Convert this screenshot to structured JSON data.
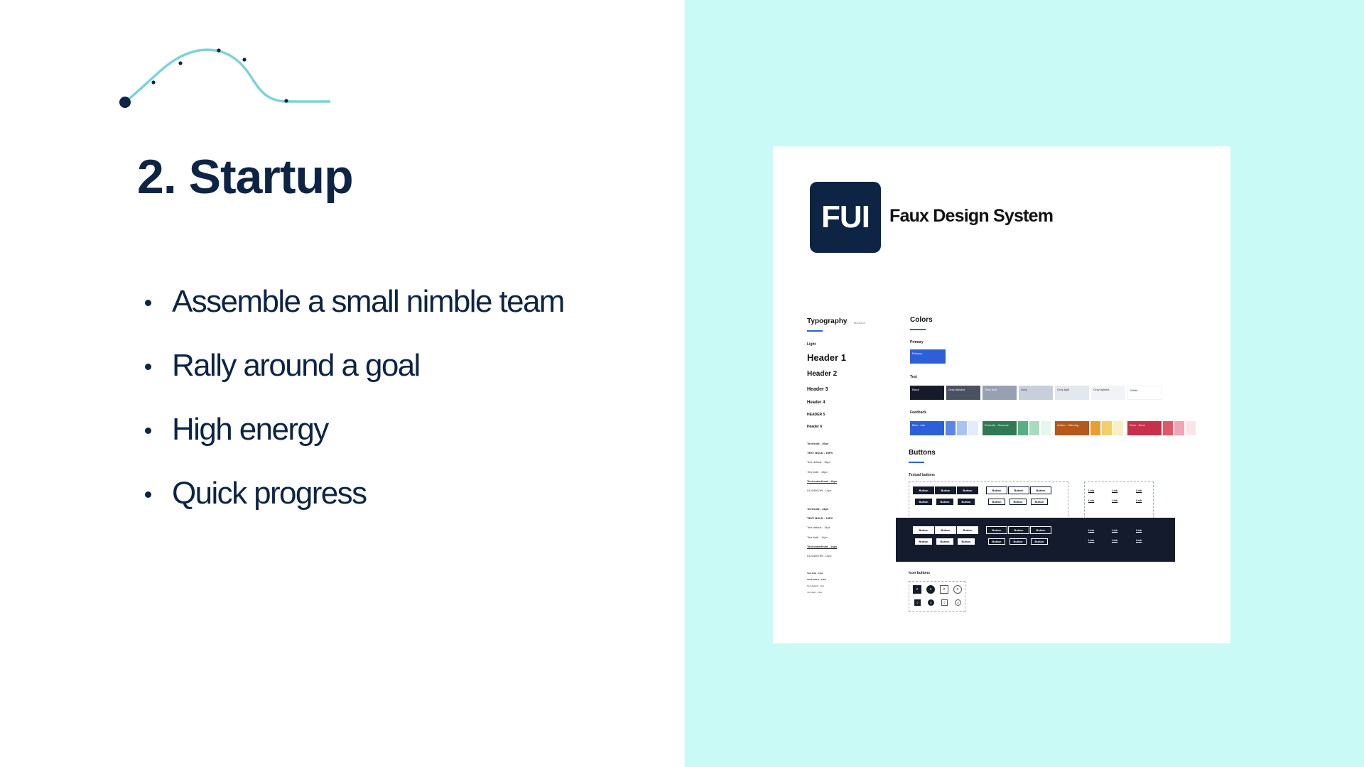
{
  "slide": {
    "title": "2. Startup",
    "bullets": [
      "Assemble a small nimble team",
      "Rally around a goal",
      "High energy",
      "Quick progress"
    ]
  },
  "colors": {
    "navy": "#0d2444",
    "teal": "#7cd3d8",
    "mint_background": "#c9faf5"
  },
  "design_system": {
    "logo_text": "FUI",
    "name": "Faux Design System",
    "typography": {
      "title": "Typography",
      "tag": "Manrope",
      "style_label": "Light",
      "headers": [
        "Header 1",
        "Header 2",
        "Header 3",
        "Header 4",
        "HEADER 5",
        "Header 6"
      ],
      "text_styles_a": [
        "Text bold - 16px",
        "TEXT BOLD - 15PX",
        "Text default - 16px",
        "Text italic - 16px",
        "Text underlined - 16px",
        "0123456789 - 14px"
      ],
      "text_styles_b": [
        "Text bold - 14px",
        "TEXT BOLD - 14PX",
        "Text default - 14px",
        "Text italic - 14px",
        "Text underlined - 14px",
        "0123456789 - 14px"
      ],
      "text_styles_c": [
        "Text bold - 11px",
        "TEXT BOLD - 11PX",
        "Text default - 11px",
        "Text italic - 11px"
      ]
    },
    "colors_section": {
      "title": "Colors",
      "primary_label": "Primary",
      "primary_swatch": {
        "name": "Primary",
        "hex": "#2f5fd8"
      },
      "text_label": "Text",
      "text_swatches": [
        {
          "name": "Black",
          "hex": "#151b2b"
        },
        {
          "name": "Grey darkest",
          "hex": "#4a5263"
        },
        {
          "name": "Grey dark",
          "hex": "#97a0b1"
        },
        {
          "name": "Grey",
          "hex": "#c9cfda"
        },
        {
          "name": "Grey light",
          "hex": "#e3e7ee"
        },
        {
          "name": "Grey lightest",
          "hex": "#f1f3f7"
        },
        {
          "name": "White",
          "hex": "#ffffff"
        }
      ],
      "feedback_label": "Feedback",
      "feedback_swatches": [
        {
          "name": "Blue - Info",
          "hex": "#2d5fd6",
          "tints": [
            "#5b86e6",
            "#a7c2f4",
            "#e3ecfc"
          ]
        },
        {
          "name": "Emerald - Success",
          "hex": "#2f7a55",
          "tints": [
            "#57b083",
            "#a6dcc0",
            "#e5f6ed"
          ]
        },
        {
          "name": "Amber - Warning",
          "hex": "#b4581d",
          "tints": [
            "#e59f32",
            "#f5ce6a",
            "#fbeec5"
          ]
        },
        {
          "name": "Rose - Error",
          "hex": "#c8304a",
          "tints": [
            "#e2566c",
            "#f0a6b2",
            "#fbe4e8"
          ]
        }
      ]
    },
    "buttons_section": {
      "title": "Buttons",
      "textual_label": "Textual buttons",
      "button_label": "Button",
      "link_label": "Link",
      "icon_label": "Icon buttons"
    }
  }
}
